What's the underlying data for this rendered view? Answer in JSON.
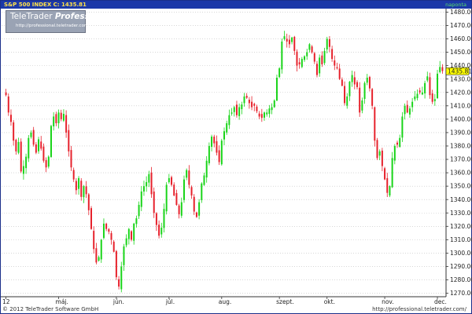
{
  "header": {
    "title": "S&P 500 INDEX C: 1435.81",
    "period": "naponta"
  },
  "watermark": {
    "title_plain": "TeleTrader",
    "title_bold": "Professional",
    "url": "http://professional.teletrader.com/"
  },
  "footer": {
    "copyright": "© 2012 TeleTrader Software GmbH",
    "url": "http://professional.teletrader.com/"
  },
  "colors": {
    "up": "#17d417",
    "down": "#e6202a",
    "grid": "#c0c0c0",
    "header": "#1c38a8",
    "last_price_bg": "#ffff00"
  },
  "chart_data": {
    "type": "candlestick",
    "title": "S&P 500 INDEX",
    "last_close": 1435.81,
    "last_price_label": "1435.81",
    "ylim": [
      1268,
      1482
    ],
    "y_ticks": [
      1270,
      1280,
      1290,
      1300,
      1310,
      1320,
      1330,
      1340,
      1350,
      1360,
      1370,
      1380,
      1390,
      1400,
      1410,
      1420,
      1430,
      1440,
      1450,
      1460,
      1470,
      1480
    ],
    "y_tick_labels": [
      "1270.00",
      "1280.00",
      "1290.00",
      "1300.00",
      "1310.00",
      "1320.00",
      "1330.00",
      "1340.00",
      "1350.00",
      "1360.00",
      "1370.00",
      "1380.00",
      "1390.00",
      "1400.00",
      "1410.00",
      "1420.00",
      "1430.00",
      "1440.00",
      "1450.00",
      "1460.00",
      "1470.00",
      "1480.00"
    ],
    "x_labels": [
      {
        "label": "12",
        "index": 0
      },
      {
        "label": "máj.",
        "index": 21
      },
      {
        "label": "jún.",
        "index": 44
      },
      {
        "label": "júl.",
        "index": 65
      },
      {
        "label": "aug.",
        "index": 86
      },
      {
        "label": "szept.",
        "index": 109
      },
      {
        "label": "okt.",
        "index": 128
      },
      {
        "label": "nov.",
        "index": 151
      },
      {
        "label": "dec.",
        "index": 172
      }
    ],
    "grid": "horizontal dotted",
    "closes": [
      1418,
      1405,
      1398,
      1384,
      1376,
      1383,
      1361,
      1365,
      1372,
      1386,
      1390,
      1381,
      1375,
      1385,
      1378,
      1369,
      1364,
      1372,
      1395,
      1402,
      1397,
      1405,
      1400,
      1404,
      1390,
      1376,
      1364,
      1355,
      1347,
      1356,
      1342,
      1350,
      1344,
      1332,
      1318,
      1303,
      1293,
      1297,
      1310,
      1322,
      1318,
      1316,
      1310,
      1301,
      1282,
      1275,
      1290,
      1305,
      1311,
      1318,
      1310,
      1322,
      1326,
      1336,
      1346,
      1350,
      1353,
      1359,
      1344,
      1330,
      1321,
      1313,
      1319,
      1333,
      1351,
      1356,
      1351,
      1343,
      1336,
      1329,
      1338,
      1355,
      1362,
      1351,
      1343,
      1331,
      1327,
      1338,
      1352,
      1358,
      1369,
      1380,
      1387,
      1382,
      1375,
      1368,
      1384,
      1391,
      1397,
      1403,
      1405,
      1409,
      1403,
      1409,
      1411,
      1417,
      1416,
      1412,
      1409,
      1410,
      1406,
      1402,
      1401,
      1405,
      1405,
      1408,
      1409,
      1414,
      1431,
      1438,
      1458,
      1462,
      1458,
      1456,
      1461,
      1451,
      1440,
      1441,
      1445,
      1447,
      1450,
      1456,
      1450,
      1443,
      1433,
      1446,
      1441,
      1451,
      1460,
      1454,
      1445,
      1440,
      1438,
      1430,
      1425,
      1412,
      1417,
      1428,
      1433,
      1426,
      1424,
      1405,
      1414,
      1427,
      1431,
      1423,
      1410,
      1384,
      1371,
      1376,
      1365,
      1355,
      1345,
      1350,
      1371,
      1380,
      1381,
      1386,
      1402,
      1410,
      1405,
      1408,
      1413,
      1417,
      1419,
      1420,
      1420,
      1427,
      1432,
      1418,
      1413,
      1415,
      1434,
      1439,
      1436
    ]
  }
}
